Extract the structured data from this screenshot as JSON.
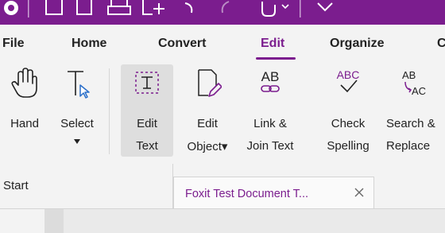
{
  "ribbon_tabs": {
    "file": "File",
    "home": "Home",
    "convert": "Convert",
    "edit": "Edit",
    "organize": "Organize",
    "more": "C"
  },
  "tools": {
    "hand": {
      "line1": "Hand",
      "icon": "hand-icon"
    },
    "select": {
      "line1": "Select",
      "icon": "select-text-icon"
    },
    "edit_text": {
      "line1": "Edit",
      "line2": "Text",
      "icon": "edit-text-icon"
    },
    "edit_object": {
      "line1": "Edit",
      "line2": "Object▾",
      "icon": "edit-object-icon"
    },
    "link_join": {
      "line1": "Link &",
      "line2": "Join Text",
      "icon": "link-join-icon"
    },
    "check_spelling": {
      "line1": "Check",
      "line2": "Spelling",
      "icon": "spell-check-icon"
    },
    "search_replace": {
      "line1": "Search &",
      "line2": "Replace",
      "icon": "search-replace-icon"
    }
  },
  "document_tabs": {
    "start": "Start",
    "active": "Foxit Test Document T..."
  },
  "colors": {
    "accent": "#7b1d8e",
    "ribbon_bg": "#f3f3f3",
    "selected_bg": "#dedede"
  }
}
